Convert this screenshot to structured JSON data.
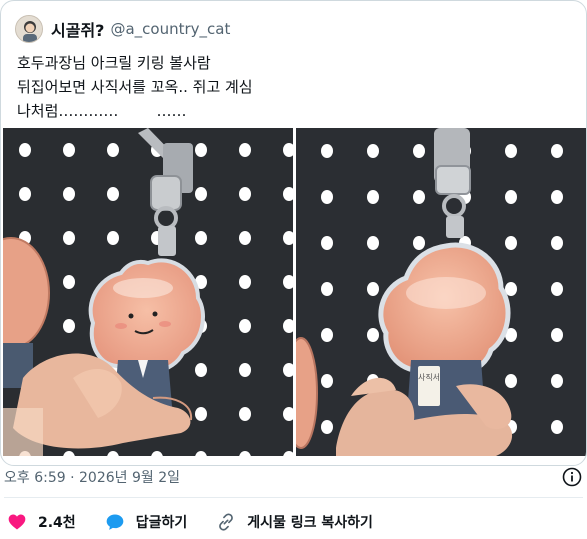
{
  "tweet": {
    "author": {
      "display_name": "시골쥐?",
      "handle": "@a_country_cat"
    },
    "text_lines": [
      "호두과장님 아크릴 키링 볼사람",
      "뒤집어보면 사직서를 꼬옥.. 쥐고 계심",
      "나처럼…………        ……"
    ],
    "timestamp": "오후 6:59 · 2026년 9월 2일",
    "photos": [
      {
        "icon": "keyring-photo-front"
      },
      {
        "icon": "keyring-photo-back",
        "paper_text": "사직서"
      }
    ]
  },
  "actions": {
    "like": {
      "count": "2.4천",
      "icon": "heart-icon"
    },
    "reply": {
      "label": "답글하기",
      "icon": "speech-bubble-icon"
    },
    "copy_link": {
      "label": "게시물 링크 복사하기",
      "icon": "link-icon"
    }
  },
  "colors": {
    "like": "#f91880",
    "reply": "#1d9bf0",
    "border": "#cfd9de",
    "secondary_text": "#536471"
  }
}
